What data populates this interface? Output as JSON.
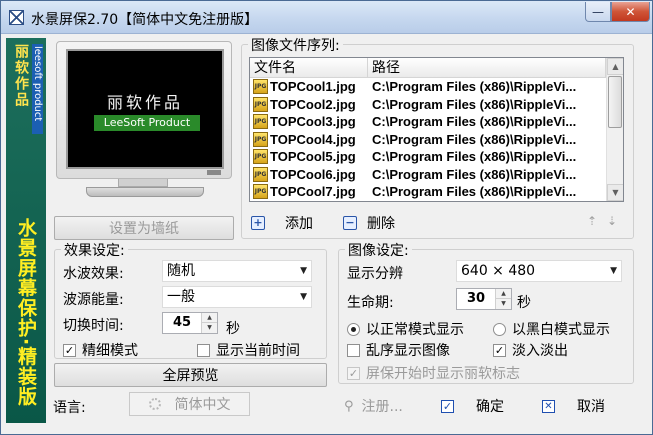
{
  "window": {
    "title": "水景屏保2.70【简体中文免注册版】",
    "minimize_glyph": "—",
    "close_glyph": "✕"
  },
  "branding": {
    "strip_cn": "丽软作品",
    "strip_en": "leesoft product",
    "vertical_title": "水景屏幕保护·精装版",
    "screen_cn": "丽软作品",
    "screen_en": "LeeSoft Product"
  },
  "preview": {
    "set_wallpaper_label": "设置为墙纸",
    "fullscreen_preview_label": "全屏预览"
  },
  "image_sequence": {
    "title": "图像文件序列:",
    "columns": [
      "文件名",
      "路径"
    ],
    "icon_text": "JPG",
    "rows": [
      {
        "file": "TOPCool1.jpg",
        "path": "C:\\Program Files (x86)\\RippleVi..."
      },
      {
        "file": "TOPCool2.jpg",
        "path": "C:\\Program Files (x86)\\RippleVi..."
      },
      {
        "file": "TOPCool3.jpg",
        "path": "C:\\Program Files (x86)\\RippleVi..."
      },
      {
        "file": "TOPCool4.jpg",
        "path": "C:\\Program Files (x86)\\RippleVi..."
      },
      {
        "file": "TOPCool5.jpg",
        "path": "C:\\Program Files (x86)\\RippleVi..."
      },
      {
        "file": "TOPCool6.jpg",
        "path": "C:\\Program Files (x86)\\RippleVi..."
      },
      {
        "file": "TOPCool7.jpg",
        "path": "C:\\Program Files (x86)\\RippleVi..."
      }
    ],
    "add_label": "添加",
    "delete_label": "删除",
    "add_glyph": "+",
    "delete_glyph": "−",
    "move_up_glyph": "⇡",
    "move_down_glyph": "⇣",
    "scroll_up_glyph": "▲",
    "scroll_down_glyph": "▼"
  },
  "effects": {
    "title": "效果设定:",
    "ripple_label": "水波效果:",
    "ripple_value": "随机",
    "energy_label": "波源能量:",
    "energy_value": "一般",
    "switch_label": "切换时间:",
    "switch_value": "45",
    "switch_unit": "秒",
    "fine_mode_label": "精细模式",
    "fine_mode_checked": "✓",
    "show_time_label": "显示当前时间",
    "show_time_checked": "",
    "dropdown_glyph": "▼",
    "spin_up_glyph": "▲",
    "spin_down_glyph": "▼"
  },
  "image_settings": {
    "title": "图像设定:",
    "resolution_label": "显示分辨",
    "resolution_value": "640 × 480",
    "lifetime_label": "生命期:",
    "lifetime_value": "30",
    "lifetime_unit": "秒",
    "normal_mode_label": "以正常模式显示",
    "bw_mode_label": "以黑白模式显示",
    "shuffle_label": "乱序显示图像",
    "shuffle_checked": "",
    "fade_label": "淡入淡出",
    "fade_checked": "✓",
    "logo_label": "屏保开始时显示丽软标志",
    "logo_checked": "✓"
  },
  "footer": {
    "language_label": "语言:",
    "language_value": "简体中文",
    "register_label": "注册...",
    "ok_label": "确定",
    "cancel_label": "取消",
    "register_glyph": "⚲",
    "ok_glyph": "✓",
    "cancel_glyph": "✕"
  }
}
